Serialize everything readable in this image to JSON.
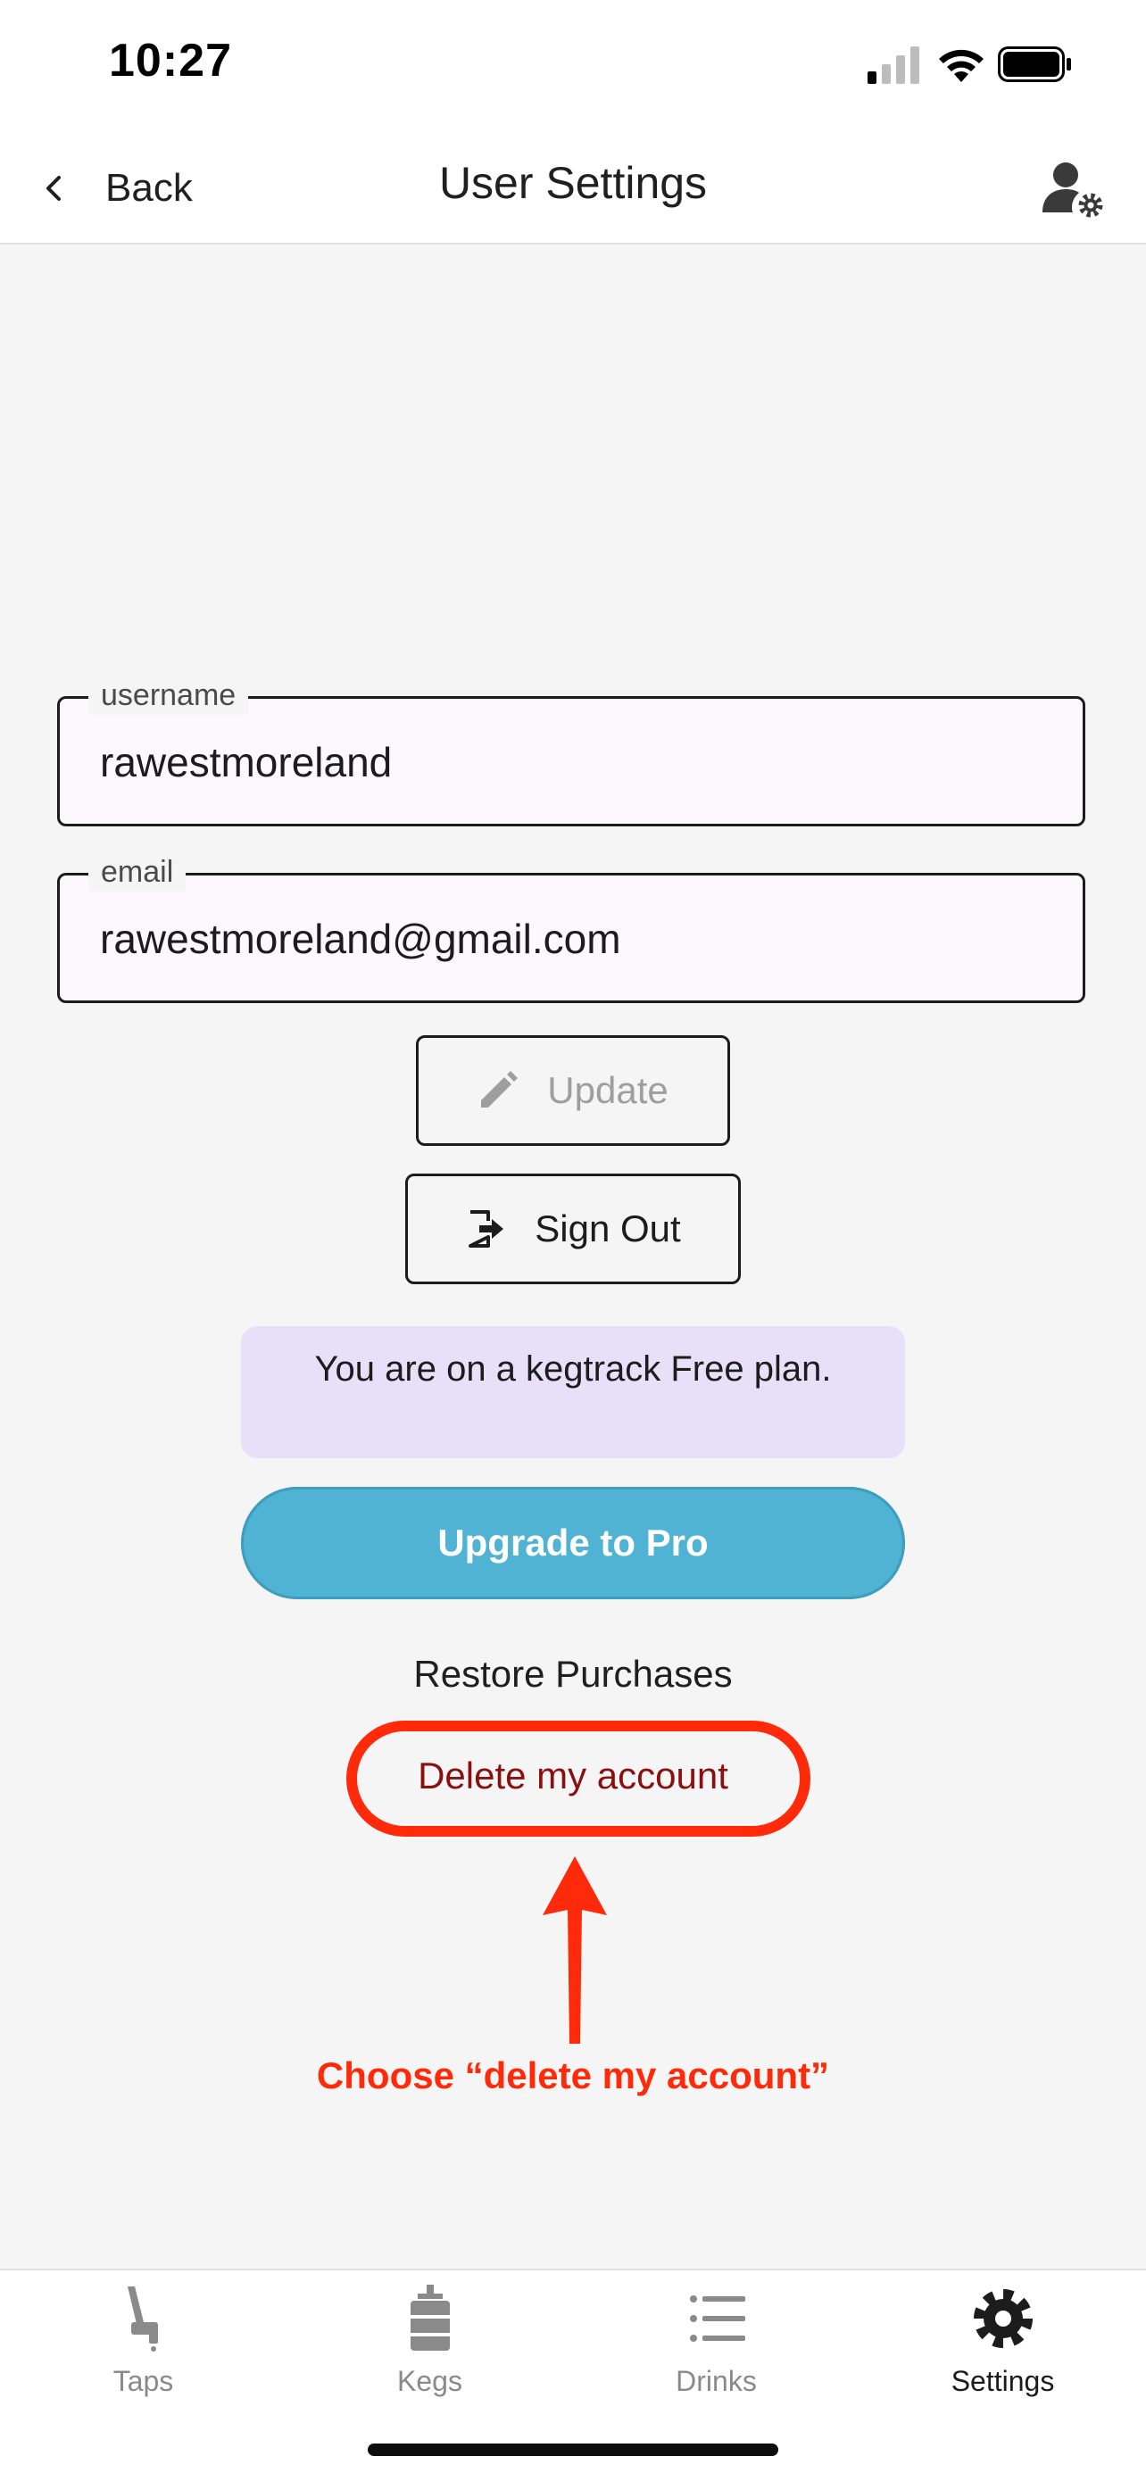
{
  "status_bar": {
    "time": "10:27"
  },
  "nav": {
    "back_label": "Back",
    "title": "User Settings",
    "right_icon": "user-gear-icon"
  },
  "form": {
    "username": {
      "label": "username",
      "value": "rawestmoreland"
    },
    "email": {
      "label": "email",
      "value": "rawestmoreland@gmail.com"
    }
  },
  "buttons": {
    "update": {
      "label": "Update",
      "icon": "pencil-icon",
      "enabled": false
    },
    "sign_out": {
      "label": "Sign Out",
      "icon": "sign-out-icon"
    },
    "upgrade": {
      "label": "Upgrade to Pro"
    },
    "restore": {
      "label": "Restore Purchases"
    },
    "delete": {
      "label": "Delete my account"
    }
  },
  "plan": {
    "text": "You are on a kegtrack Free plan."
  },
  "annotation": {
    "text": "Choose “delete my account”",
    "color": "#ff2a0a"
  },
  "tabs": [
    {
      "label": "Taps",
      "icon": "tap-icon",
      "active": false
    },
    {
      "label": "Kegs",
      "icon": "keg-icon",
      "active": false
    },
    {
      "label": "Drinks",
      "icon": "list-icon",
      "active": false
    },
    {
      "label": "Settings",
      "icon": "gear-icon",
      "active": true
    }
  ],
  "colors": {
    "accent": "#50b3d3",
    "plan_bg": "#e8dff8",
    "danger": "#8a1010"
  }
}
